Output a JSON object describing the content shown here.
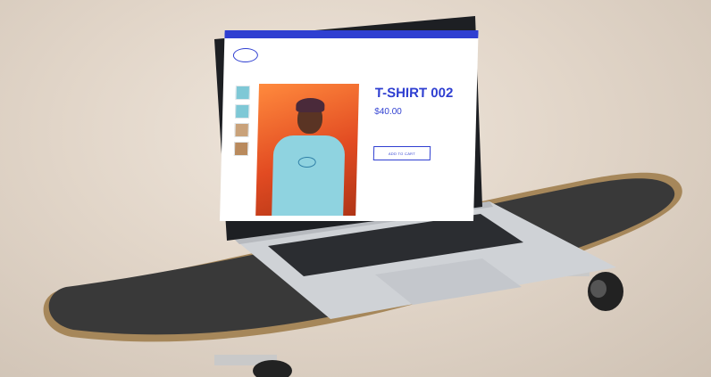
{
  "product": {
    "title": "T-SHIRT 002",
    "price": "$40.00",
    "add_to_cart_label": "ADD TO CART"
  },
  "colors": {
    "brand_blue": "#2f3fd1",
    "photo_orange": "#e24b22",
    "shirt_blue": "#8fd3e0",
    "skate_grip": "#3a3a3a",
    "laptop_silver": "#cfd2d6"
  }
}
